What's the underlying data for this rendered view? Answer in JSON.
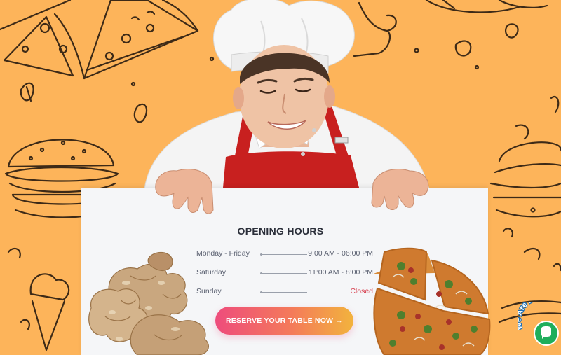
{
  "opening_hours": {
    "title": "OPENING HOURS",
    "rows": [
      {
        "day": "Monday - Friday",
        "hours": "9:00 AM - 06:00 PM"
      },
      {
        "day": "Saturday",
        "hours": "11:00 AM - 8:00 PM"
      },
      {
        "day": "Sunday",
        "hours": "Closed"
      }
    ]
  },
  "cta": {
    "label": "RESERVE YOUR TABLE NOW →"
  },
  "chat": {
    "label": "We Are Here!"
  },
  "colors": {
    "background": "#fdb45a",
    "board": "#f5f6f8",
    "title_text": "#2b2f3a",
    "closed_text": "#d63a4a",
    "button_gradient": [
      "#ee4c7c",
      "#f2b33d"
    ],
    "apron": "#c8201f",
    "chat_bubble": "#1fae5b"
  },
  "icons": [
    "arrow-right-icon",
    "chat-bubble-icon"
  ]
}
